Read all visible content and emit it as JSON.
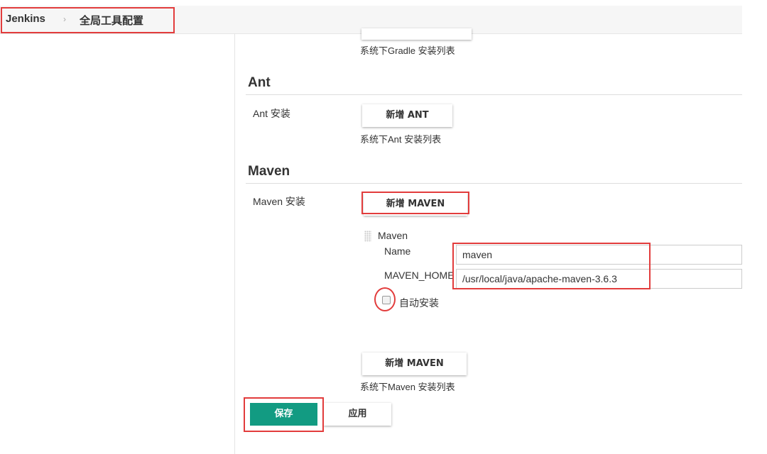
{
  "breadcrumb": {
    "root": "Jenkins",
    "separator": "›",
    "current": "全局工具配置"
  },
  "gradle": {
    "help": "系统下Gradle 安装列表"
  },
  "ant": {
    "title": "Ant",
    "install_label": "Ant 安装",
    "add_button": "新增 ANT",
    "help": "系统下Ant 安装列表"
  },
  "maven": {
    "title": "Maven",
    "install_label": "Maven 安装",
    "add_button": "新增 MAVEN",
    "installation": {
      "header": "Maven",
      "name_label": "Name",
      "name_value": "maven",
      "home_label": "MAVEN_HOME",
      "home_value": "/usr/local/java/apache-maven-3.6.3",
      "auto_install_label": "自动安装",
      "auto_install_checked": false
    },
    "add_button_bottom": "新增 MAVEN",
    "help": "系统下Maven 安装列表"
  },
  "actions": {
    "save": "保存",
    "apply": "应用"
  },
  "colors": {
    "save_button": "#129b82",
    "highlight": "#e23c3c"
  }
}
